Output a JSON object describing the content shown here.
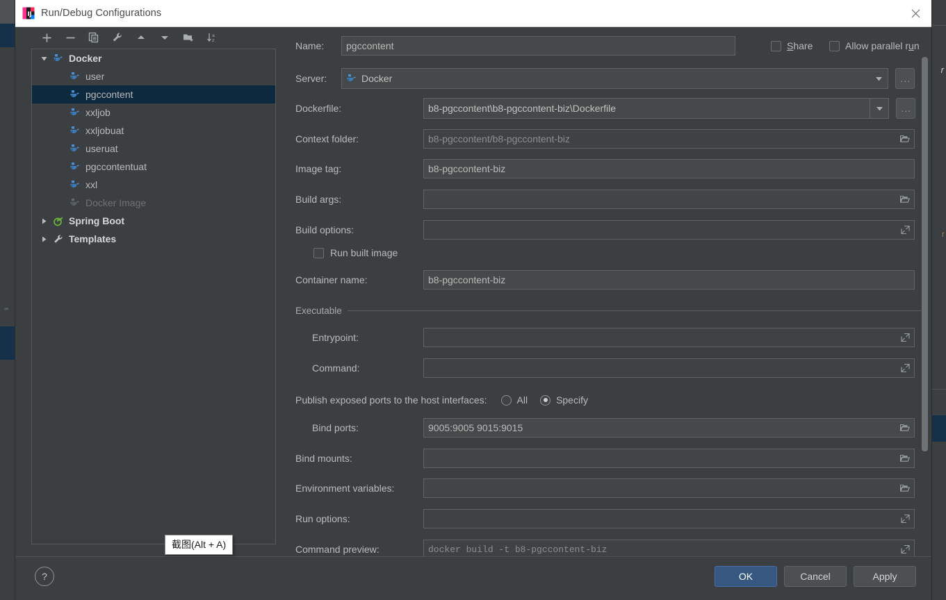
{
  "window": {
    "title": "Run/Debug Configurations",
    "app_icon": "intellij-idea-icon",
    "close_icon": "close-icon"
  },
  "toolbar": {
    "buttons": [
      {
        "name": "add-configuration-button",
        "icon": "plus-icon"
      },
      {
        "name": "remove-configuration-button",
        "icon": "minus-icon"
      },
      {
        "name": "copy-configuration-button",
        "icon": "copy-icon"
      },
      {
        "name": "edit-templates-button",
        "icon": "wrench-icon"
      },
      {
        "name": "move-up-button",
        "icon": "arrow-up-icon"
      },
      {
        "name": "move-down-button",
        "icon": "arrow-down-icon"
      },
      {
        "name": "new-folder-button",
        "icon": "folder-plus-icon"
      },
      {
        "name": "sort-alphabetically-button",
        "icon": "sort-az-icon"
      }
    ]
  },
  "tree": {
    "nodes": [
      {
        "label": "Docker",
        "type": "group",
        "icon": "docker-icon",
        "expanded": true,
        "selected": false,
        "disabled": false
      },
      {
        "label": "user",
        "type": "child",
        "icon": "docker-icon",
        "selected": false,
        "disabled": false
      },
      {
        "label": "pgccontent",
        "type": "child",
        "icon": "docker-icon",
        "selected": true,
        "disabled": false
      },
      {
        "label": "xxljob",
        "type": "child",
        "icon": "docker-icon",
        "selected": false,
        "disabled": false
      },
      {
        "label": "xxljobuat",
        "type": "child",
        "icon": "docker-icon",
        "selected": false,
        "disabled": false
      },
      {
        "label": "useruat",
        "type": "child",
        "icon": "docker-icon",
        "selected": false,
        "disabled": false
      },
      {
        "label": "pgccontentuat",
        "type": "child",
        "icon": "docker-icon",
        "selected": false,
        "disabled": false
      },
      {
        "label": "xxl",
        "type": "child",
        "icon": "docker-icon",
        "selected": false,
        "disabled": false
      },
      {
        "label": "Docker Image",
        "type": "child",
        "icon": "docker-icon",
        "selected": false,
        "disabled": true
      },
      {
        "label": "Spring Boot",
        "type": "group",
        "icon": "spring-boot-icon",
        "expanded": false,
        "selected": false,
        "disabled": false
      },
      {
        "label": "Templates",
        "type": "group",
        "icon": "wrench-icon",
        "expanded": false,
        "selected": false,
        "disabled": false
      }
    ]
  },
  "tooltip": {
    "text": "截图(Alt + A)"
  },
  "form": {
    "name": {
      "label": "Name:",
      "value": "pgccontent"
    },
    "share": {
      "label": "Share",
      "checked": false,
      "mnemonic": "S"
    },
    "allow_parallel_run": {
      "label": "Allow parallel run",
      "checked": false,
      "mnemonic": "u"
    },
    "server": {
      "label": "Server:",
      "value": "Docker",
      "icon": "docker-icon",
      "browse_label": "..."
    },
    "dockerfile": {
      "label": "Dockerfile:",
      "value": "b8-pgccontent\\b8-pgccontent-biz\\Dockerfile",
      "browse_label": "..."
    },
    "context_folder": {
      "label": "Context folder:",
      "value": "b8-pgccontent/b8-pgccontent-biz",
      "readonly": true,
      "icon": "folder-icon"
    },
    "image_tag": {
      "label": "Image tag:",
      "value": "b8-pgccontent-biz"
    },
    "build_args": {
      "label": "Build args:",
      "value": "",
      "icon": "folder-icon"
    },
    "build_options": {
      "label": "Build options:",
      "value": "",
      "icon": "expand-icon"
    },
    "run_built_image": {
      "label": "Run built image",
      "checked": false
    },
    "container_name": {
      "label": "Container name:",
      "value": "b8-pgccontent-biz"
    },
    "executable_section": {
      "label": "Executable"
    },
    "entrypoint": {
      "label": "Entrypoint:",
      "value": "",
      "icon": "expand-icon"
    },
    "command": {
      "label": "Command:",
      "value": "",
      "icon": "expand-icon"
    },
    "publish_ports": {
      "label": "Publish exposed ports to the host interfaces:",
      "options": [
        {
          "label": "All",
          "selected": false
        },
        {
          "label": "Specify",
          "selected": true
        }
      ]
    },
    "bind_ports": {
      "label": "Bind ports:",
      "value": "9005:9005 9015:9015",
      "icon": "folder-icon"
    },
    "bind_mounts": {
      "label": "Bind mounts:",
      "value": "",
      "icon": "folder-icon"
    },
    "environment_variables": {
      "label": "Environment variables:",
      "value": "",
      "icon": "folder-icon"
    },
    "run_options": {
      "label": "Run options:",
      "value": "",
      "icon": "expand-icon"
    },
    "command_preview": {
      "label": "Command preview:",
      "value": "docker build -t b8-pgccontent-biz",
      "readonly": true,
      "icon": "expand-icon"
    }
  },
  "footer": {
    "help_label": "?",
    "ok_label": "OK",
    "cancel_label": "Cancel",
    "apply_label": "Apply"
  },
  "colors": {
    "dialog_bg": "#3c3f41",
    "titlebar_bg": "#ffffff",
    "selection_bg": "#0d293e",
    "primary_button": "#365880",
    "docker_blue": "#4a90d9",
    "spring_green": "#6db33f"
  }
}
